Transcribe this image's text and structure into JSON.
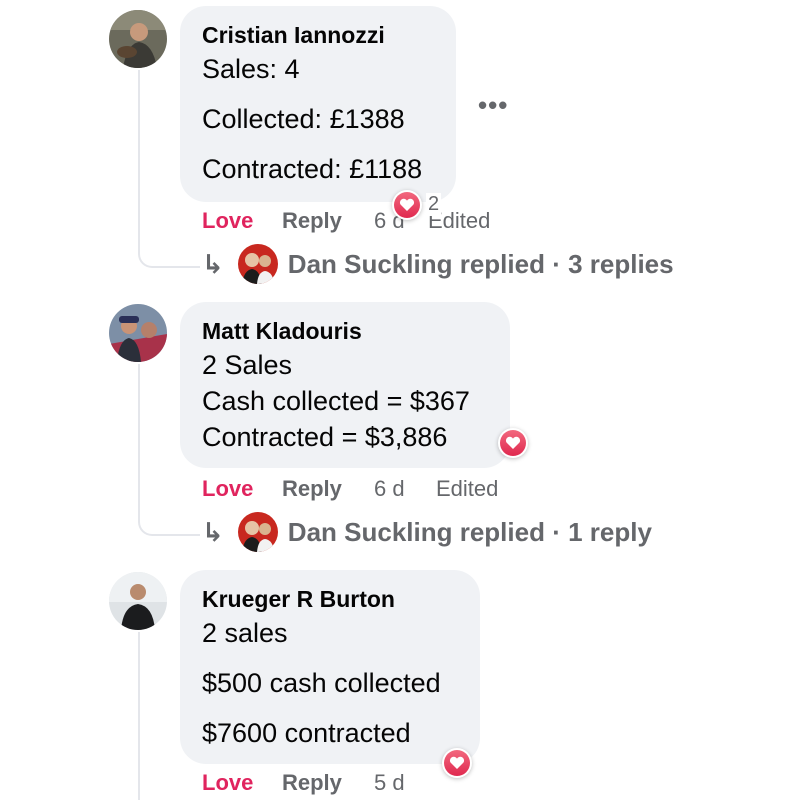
{
  "comments": [
    {
      "author": "Cristian Iannozzi",
      "lines": [
        "Sales: 4",
        "Collected: £1388",
        "Contracted: £1188"
      ],
      "actions": {
        "love": "Love",
        "reply": "Reply",
        "time": "6 d",
        "edited": "Edited"
      },
      "reaction": {
        "type": "love-heart-icon",
        "count": "2"
      },
      "replies": {
        "name": "Dan Suckling",
        "text": "Dan Suckling replied · 3 replies"
      }
    },
    {
      "author": "Matt Kladouris",
      "lines": [
        "2 Sales",
        "Cash collected = $367",
        "Contracted = $3,886"
      ],
      "actions": {
        "love": "Love",
        "reply": "Reply",
        "time": "6 d",
        "edited": "Edited"
      },
      "reaction": {
        "type": "love-heart-icon",
        "count": ""
      },
      "replies": {
        "name": "Dan Suckling",
        "text": "Dan Suckling replied · 1 reply"
      }
    },
    {
      "author": "Krueger R Burton",
      "lines": [
        "2 sales",
        "$500 cash collected",
        "$7600 contracted"
      ],
      "actions": {
        "love": "Love",
        "reply": "Reply",
        "time": "5 d"
      },
      "reaction": {
        "type": "love-heart-icon",
        "count": ""
      }
    }
  ],
  "more_options_label": "•••",
  "reply_arrow": "↳",
  "colors": {
    "love": "#e0245e",
    "muted": "#65676b",
    "bubble": "#f0f2f5",
    "heart": "#e0294f"
  }
}
